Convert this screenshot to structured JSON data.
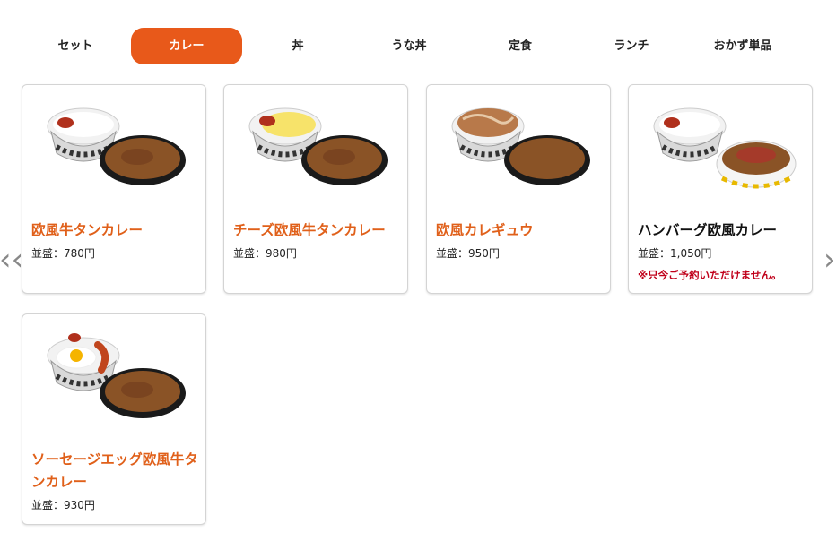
{
  "tabs": [
    {
      "label": "セット",
      "active": false
    },
    {
      "label": "カレー",
      "active": true
    },
    {
      "label": "丼",
      "active": false
    },
    {
      "label": "うな丼",
      "active": false
    },
    {
      "label": "定食",
      "active": false
    },
    {
      "label": "ランチ",
      "active": false
    },
    {
      "label": "おかず単品",
      "active": false
    }
  ],
  "nav": {
    "prev_icon": "‹‹",
    "next_icon": "››"
  },
  "colors": {
    "accent": "#e8591a",
    "name": "#e0601a",
    "note": "#c0001a"
  },
  "products": [
    {
      "name": "欧風牛タンカレー",
      "price": "並盛：780円",
      "note": "",
      "topping": "red-pickles"
    },
    {
      "name": "チーズ欧風牛タンカレー",
      "price": "並盛：980円",
      "note": "",
      "topping": "cheese"
    },
    {
      "name": "欧風カレギュウ",
      "price": "並盛：950円",
      "note": "",
      "topping": "gyu"
    },
    {
      "name": "ハンバーグ欧風カレー",
      "price": "並盛：1,050円",
      "note": "※只今ご予約いただけません。",
      "topping": "hamburg"
    },
    {
      "name": "ソーセージエッグ欧風牛タンカレー",
      "price": "並盛：930円",
      "note": "",
      "topping": "sausage-egg"
    }
  ]
}
